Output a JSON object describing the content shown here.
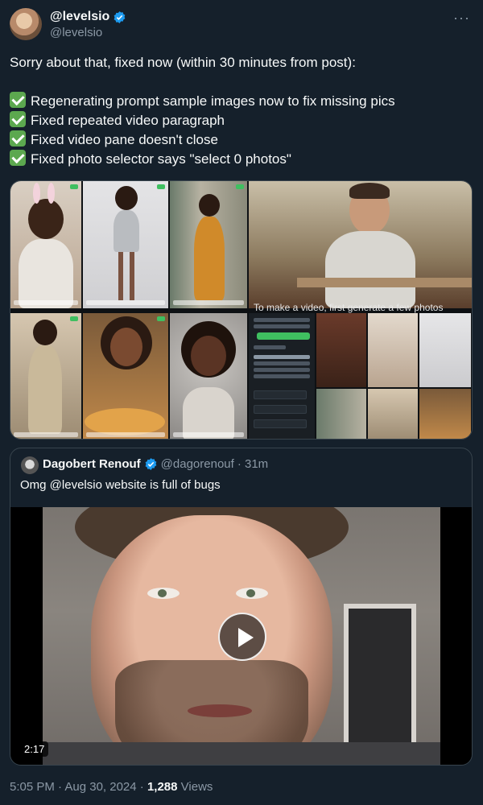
{
  "author": {
    "display_name": "@levelsio",
    "handle": "@levelsio",
    "verified_icon": "verified-badge-icon",
    "more_label": "···"
  },
  "tweet": {
    "intro": "Sorry about that, fixed now (within 30 minutes from post):",
    "items": [
      "Regenerating prompt sample images now to fix missing pics",
      "Fixed repeated video paragraph",
      "Fixed video pane doesn't close",
      "Fixed photo selector says \"select 0 photos\""
    ]
  },
  "media": {
    "overlay_text": "To make a video, first generate a few photos"
  },
  "quoted_tweet": {
    "display_name": "Dagobert Renouf",
    "handle": "@dagorenouf",
    "time": "· 31m",
    "text": "Omg @levelsio website is full of bugs",
    "video_duration": "2:17"
  },
  "meta": {
    "time": "5:05 PM · Aug 30, 2024 · ",
    "views_count": "1,288",
    "views_label": " Views"
  },
  "colors": {
    "background": "#15202b",
    "verified": "#1d9bf0",
    "check": "#5ca84f",
    "muted": "#8b98a5"
  }
}
